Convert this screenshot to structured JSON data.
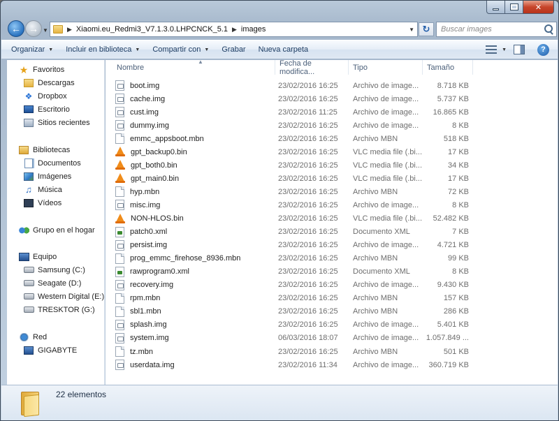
{
  "address": {
    "segments": [
      "Xiaomi.eu_Redmi3_V7.1.3.0.LHPCNCK_5.1",
      "images"
    ],
    "search_placeholder": "Buscar images"
  },
  "toolbar": {
    "organize": "Organizar",
    "include": "Incluir en biblioteca",
    "share": "Compartir con",
    "burn": "Grabar",
    "new_folder": "Nueva carpeta"
  },
  "sidebar": {
    "favorites": "Favoritos",
    "favorites_items": [
      "Descargas",
      "Dropbox",
      "Escritorio",
      "Sitios recientes"
    ],
    "libraries": "Bibliotecas",
    "libraries_items": [
      "Documentos",
      "Imágenes",
      "Música",
      "Vídeos"
    ],
    "homegroup": "Grupo en el hogar",
    "computer": "Equipo",
    "computer_items": [
      "Samsung (C:)",
      "Seagate (D:)",
      "Western Digital (E:)",
      "TRESKTOR (G:)"
    ],
    "network": "Red",
    "network_items": [
      "GIGABYTE"
    ]
  },
  "columns": {
    "name": "Nombre",
    "date": "Fecha de modifica...",
    "type": "Tipo",
    "size": "Tamaño"
  },
  "files": [
    {
      "name": "boot.img",
      "date": "23/02/2016 16:25",
      "type": "Archivo de image...",
      "size": "8.718 KB",
      "icon": "img"
    },
    {
      "name": "cache.img",
      "date": "23/02/2016 16:25",
      "type": "Archivo de image...",
      "size": "5.737 KB",
      "icon": "img"
    },
    {
      "name": "cust.img",
      "date": "23/02/2016 11:25",
      "type": "Archivo de image...",
      "size": "16.865 KB",
      "icon": "img"
    },
    {
      "name": "dummy.img",
      "date": "23/02/2016 16:25",
      "type": "Archivo de image...",
      "size": "8 KB",
      "icon": "img"
    },
    {
      "name": "emmc_appsboot.mbn",
      "date": "23/02/2016 16:25",
      "type": "Archivo MBN",
      "size": "518 KB",
      "icon": "generic"
    },
    {
      "name": "gpt_backup0.bin",
      "date": "23/02/2016 16:25",
      "type": "VLC media file (.bi...",
      "size": "17 KB",
      "icon": "vlc"
    },
    {
      "name": "gpt_both0.bin",
      "date": "23/02/2016 16:25",
      "type": "VLC media file (.bi...",
      "size": "34 KB",
      "icon": "vlc"
    },
    {
      "name": "gpt_main0.bin",
      "date": "23/02/2016 16:25",
      "type": "VLC media file (.bi...",
      "size": "17 KB",
      "icon": "vlc"
    },
    {
      "name": "hyp.mbn",
      "date": "23/02/2016 16:25",
      "type": "Archivo MBN",
      "size": "72 KB",
      "icon": "generic"
    },
    {
      "name": "misc.img",
      "date": "23/02/2016 16:25",
      "type": "Archivo de image...",
      "size": "8 KB",
      "icon": "img"
    },
    {
      "name": "NON-HLOS.bin",
      "date": "23/02/2016 16:25",
      "type": "VLC media file (.bi...",
      "size": "52.482 KB",
      "icon": "vlc"
    },
    {
      "name": "patch0.xml",
      "date": "23/02/2016 16:25",
      "type": "Documento XML",
      "size": "7 KB",
      "icon": "xml"
    },
    {
      "name": "persist.img",
      "date": "23/02/2016 16:25",
      "type": "Archivo de image...",
      "size": "4.721 KB",
      "icon": "img"
    },
    {
      "name": "prog_emmc_firehose_8936.mbn",
      "date": "23/02/2016 16:25",
      "type": "Archivo MBN",
      "size": "99 KB",
      "icon": "generic"
    },
    {
      "name": "rawprogram0.xml",
      "date": "23/02/2016 16:25",
      "type": "Documento XML",
      "size": "8 KB",
      "icon": "xml"
    },
    {
      "name": "recovery.img",
      "date": "23/02/2016 16:25",
      "type": "Archivo de image...",
      "size": "9.430 KB",
      "icon": "img"
    },
    {
      "name": "rpm.mbn",
      "date": "23/02/2016 16:25",
      "type": "Archivo MBN",
      "size": "157 KB",
      "icon": "generic"
    },
    {
      "name": "sbl1.mbn",
      "date": "23/02/2016 16:25",
      "type": "Archivo MBN",
      "size": "286 KB",
      "icon": "generic"
    },
    {
      "name": "splash.img",
      "date": "23/02/2016 16:25",
      "type": "Archivo de image...",
      "size": "5.401 KB",
      "icon": "img"
    },
    {
      "name": "system.img",
      "date": "06/03/2016 18:07",
      "type": "Archivo de image...",
      "size": "1.057.849 ...",
      "icon": "img"
    },
    {
      "name": "tz.mbn",
      "date": "23/02/2016 16:25",
      "type": "Archivo MBN",
      "size": "501 KB",
      "icon": "generic"
    },
    {
      "name": "userdata.img",
      "date": "23/02/2016 11:34",
      "type": "Archivo de image...",
      "size": "360.719 KB",
      "icon": "img"
    }
  ],
  "status": {
    "count": "22 elementos"
  }
}
